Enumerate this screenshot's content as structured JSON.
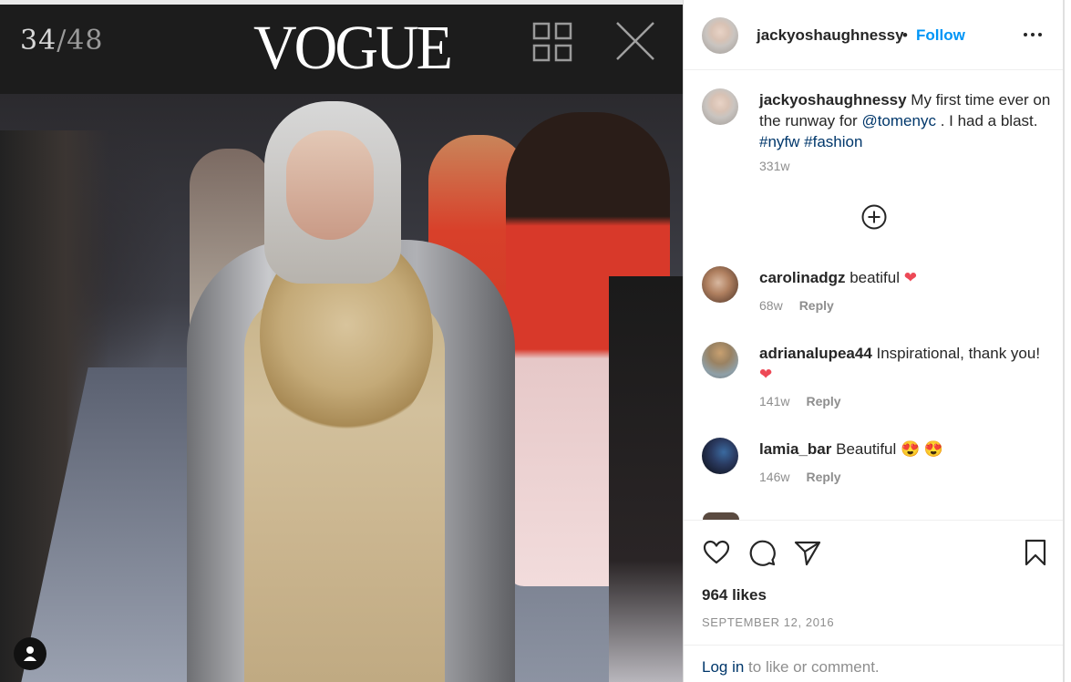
{
  "gallery": {
    "counter_current": "34",
    "counter_total": "48",
    "logo": "VOGUE",
    "grid_icon": "grid-icon",
    "close_icon": "close-icon",
    "profile_icon": "user-icon"
  },
  "post": {
    "username": "jackyoshaughnessy",
    "dot": "•",
    "follow_label": "Follow",
    "more_icon": "more-icon",
    "caption": {
      "username": "jackyoshaughnessy",
      "text_before": " My first time ever on the runway for ",
      "mention": "@tomenyc",
      "text_after": " . I had a blast. ",
      "tag1": "#nyfw",
      "tag2": "#fashion",
      "time": "331w"
    },
    "load_more_icon": "plus-circle-icon",
    "comments": [
      {
        "username": "carolinadgz",
        "text": " beatiful ",
        "emoji": "❤",
        "time": "68w",
        "reply": "Reply"
      },
      {
        "username": "adrianalupea44",
        "text": " Inspirational, thank you! ",
        "emoji": "❤",
        "time": "141w",
        "reply": "Reply"
      },
      {
        "username": "lamia_bar",
        "text": " Beautiful ",
        "emoji": "😍 😍",
        "time": "146w",
        "reply": "Reply"
      }
    ],
    "likes": "964 likes",
    "date": "SEPTEMBER 12, 2016",
    "login_link": "Log in",
    "login_text": " to like or comment."
  },
  "colors": {
    "accent": "#0095f6",
    "link": "#00376b",
    "heart": "#ed4956",
    "muted": "#8e8e8e"
  }
}
